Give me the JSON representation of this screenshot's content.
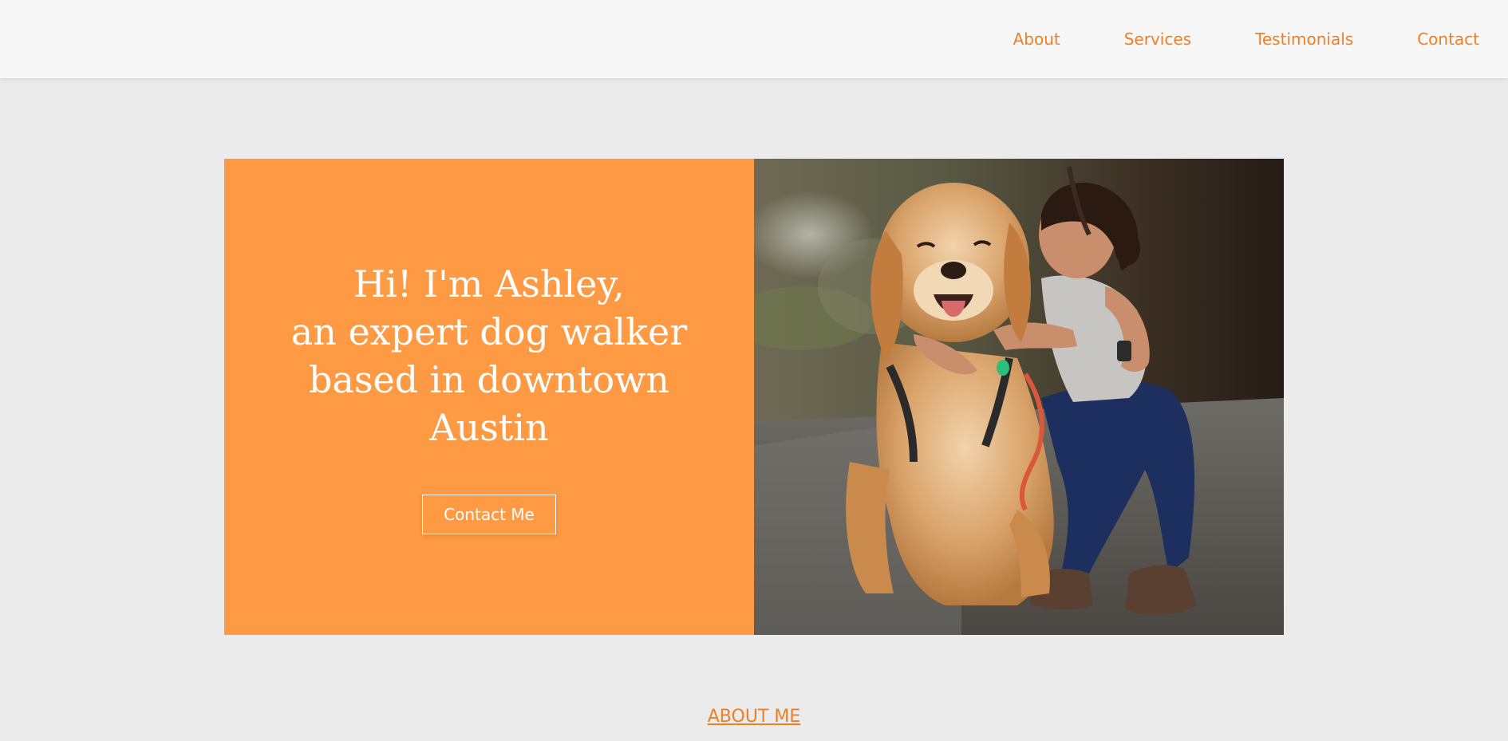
{
  "nav": {
    "items": [
      {
        "label": "About"
      },
      {
        "label": "Services"
      },
      {
        "label": "Testimonials"
      },
      {
        "label": "Contact"
      }
    ]
  },
  "hero": {
    "heading_lines": [
      "Hi! I'm Ashley,",
      "an expert dog walker",
      "based in downtown",
      "Austin"
    ],
    "button_label": "Contact Me"
  },
  "about": {
    "heading": "ABOUT ME"
  },
  "colors": {
    "accent": "#f07e24",
    "hero_panel": "#fe9a44",
    "page_background": "#ebebeb",
    "navbar_background": "#f7f7f7"
  },
  "photo": {
    "icon": "woman-kissing-golden-retriever-photo"
  }
}
